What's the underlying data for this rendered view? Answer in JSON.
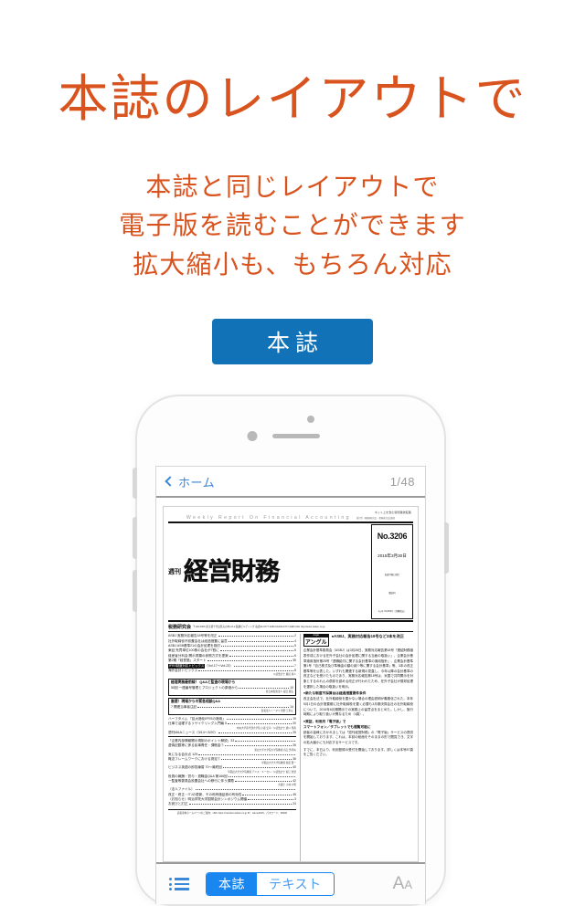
{
  "promo": {
    "headline": "本誌のレイアウトで",
    "subcopy": [
      "本誌と同じレイアウトで",
      "電子版を読むことができます",
      "拡大縮小も、もちろん対応"
    ],
    "cta_label": "本誌",
    "accent_color": "#d9531e",
    "cta_color": "#1272b8"
  },
  "app": {
    "navbar": {
      "back_label": "ホーム",
      "page_indicator": "1/48"
    },
    "toolbar": {
      "list_icon": "list-icon",
      "segment": {
        "selected": "本誌",
        "options": [
          "本誌",
          "テキスト"
        ]
      },
      "text_size_label": "AA",
      "active_color": "#1a86f0"
    }
  },
  "magazine": {
    "masthead": {
      "net_line": "ネット上を含む新聞雑誌転載",
      "net_sub": "発行所／㈱税務研究会 ・税務研究会出版局",
      "english": "Weekly Report On Financial Accounting",
      "english_bits": "税務研究会ホームページ URL http://www.zeiken.co.jp",
      "shukan": "週刊",
      "title": "経営財務",
      "issue_no": "No.3206",
      "issue_date": "2015年3月30日",
      "issue_note1": "毎週月曜日発行",
      "issue_note2": "購読料",
      "issue_note3": "1ヵ年 51,840円（消費税込）",
      "publisher": "税務研究会",
      "publisher_detail": "〒100-0005 東京都千代田区丸の内1-8-2 鉃鋼ビルディング 電話03-6777-3450 FAX03-6777-3483  URL http://www.zeiken.co.jp"
    },
    "toc": [
      {
        "title": "ASBJ  実務対応報告18号等を改正",
        "page": "2"
      },
      {
        "title": "社外取締役不設置会社は経過措置に留意",
        "page": "4"
      },
      {
        "title": "ASBJ  ASB基準21の会計処理を検討",
        "page": "5"
      },
      {
        "title": "東証  売買単位100株の会社が7割に",
        "page": "6"
      },
      {
        "title": "経産省分科会  開示書類の参照方式を提案",
        "page": "6"
      },
      {
        "title": "第2期「経営塾」スタート",
        "page": "35"
      }
    ],
    "toc_highlight": {
      "inverse": "IFRS制度対応トピックス",
      "rest": "（Vol.17～Vol.23）",
      "page": "7"
    },
    "toc_arrow": {
      "title": "海外会計トピックス",
      "authors": "公認会計士  藤田  尚人",
      "page": "8"
    },
    "toc_boxes": [
      {
        "head": "経理実務最前線！  Q&Aと監査の現場から",
        "lines": [
          {
            "title": "55回  一連番号管理とプロジェクトの原価から",
            "page": "10"
          }
        ],
        "author": "新日本監査法人  富田  憲弘"
      },
      {
        "head": "厳選！現場からの緊急相談Q&A",
        "lines": [
          {
            "title": "7  関連当事者注記",
            "page": "14"
          }
        ],
        "author": "監査法人トーマツ  角野  江利子"
      }
    ],
    "toc_tail": [
      {
        "title": "ハーフタイム  「拡大適化IFRSの適用」",
        "page": "19"
      },
      {
        "title": "仕事で活躍するリサイクリング入門編  5",
        "page": "20",
        "author": "中央大学商学部大学院  小森  宏幸／公認会計士  建川  里香"
      },
      {
        "title": "週刊M&Aニュース（3/14～3/20）",
        "page": "25"
      }
    ],
    "toc_lower": [
      {
        "title": "「企業内部情報開示規制のポイント解説」33",
        "page": ""
      },
      {
        "title": "虚偽記載等に係る民事責任・課徴金①",
        "page": "26",
        "author": "東北大学大学院大学院教授  谷口  勢津夫"
      },
      {
        "title": "気になる会計点  129",
        "page": ""
      },
      {
        "title": "概念フレームワークにおける測定①",
        "page": "36",
        "author": "早稲田大学大学院教授  秋葉  賢一"
      },
      {
        "title": "ビジネス英語の即答練習  70～最終回",
        "page": "40",
        "author": "早稲田大学大学院教授  デニス・キーセン／公認会計士  堀江  智慧"
      },
      {
        "title": "役員の報酬・賞与・退職金Q&A  第166回",
        "page": ""
      },
      {
        "title": "一監査等委員会設置会社への移行に伴う課題",
        "page": "42",
        "author": "弁護士  小林  公明"
      },
      {
        "title": "（法人ファイル）",
        "page": ""
      },
      {
        "title": "改正・修正・ITJの更新、その他有価証券の有効性",
        "page": "45"
      },
      {
        "title": "〈お知らせ〉明治学院大学国際会計シンポジウム開催",
        "page": "3"
      },
      {
        "title": "お詫びと訂正",
        "page": "24"
      }
    ],
    "footer": "読者専用ホームページのご案内：URL https://member.zeiken.co.jp  ID：zaimu2015、パスワード：38292",
    "right_column": {
      "badge_en": "Angle",
      "badge_jp": "アングル",
      "headline": "●ASBJ、実務対応報告18号など3本を改正",
      "paragraphs": [
        "企業会計基準委員会（ASBJ）は3月26日、実務対応報告第18号「連結財務諸表作成における在外子会社の会計処理に関する当面の取扱い」、企業会計基準適用指針第25号「退職給付に関する会計基準の適用指針」、企業会計基準第1号「自己株式及び準備金の額の減少等に関する会計基準」等、3本の改正基準等を公表した。いずれも関連する新規の見直し、今年以降の会計基準の改正などを受けたものであり、実務対応報告第18号は、米国で共同開示を対象とするのれんの償却を認める改正が行われたため、在外子会社が償却処理を選択した場合の取扱いを明示。",
        "●新たな制度不採算台は経過措置要件条件"
      ],
      "paragraphs2": [
        "改正会社法で、社外取締役を置かない場合の理由説明が義務化された。本年5月1日の合計措置期に社外取締役を置く必要も3月期決算会社の社外取締役について、2015年6月期開示での実務上の留意点をまとめた。しかし、施行時期により取り扱いが異なるため（4頁）。"
      ],
      "headline2": "●東証、利用月「電子版」で",
      "paragraphs3": [
        "スマートフォン／タブレットでも閲覧可能に",
        "読者の皆様におかれましては「週刊経営財務」の「電子版」サービスの提供を開始しております。これは、本誌の紙面をそのままの形で閲覧でき、文字の拡大縮小にも対応するサービスです。",
        "すでに、本日より、利用登録の受付を開始しております。詳しくは本号87頁をご覧ください。"
      ]
    }
  }
}
